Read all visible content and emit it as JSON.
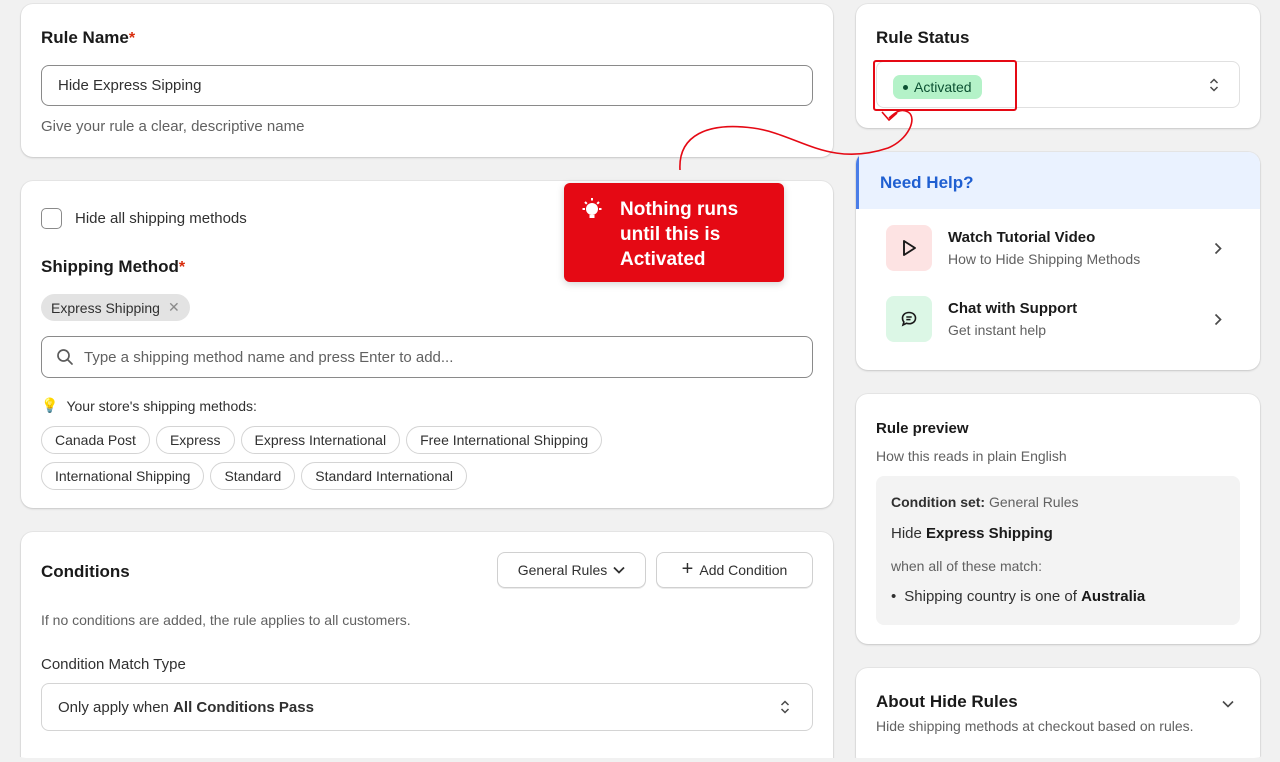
{
  "rule_name": {
    "label": "Rule Name",
    "required_mark": "*",
    "value": "Hide Express Sipping",
    "help": "Give your rule a clear, descriptive name"
  },
  "shipping": {
    "hide_all_label": "Hide all shipping methods",
    "method_label": "Shipping Method",
    "required_mark": "*",
    "selected_tag": "Express Shipping",
    "search_placeholder": "Type a shipping method name and press Enter to add...",
    "store_methods_label": "Your store's shipping methods:",
    "store_methods": [
      "Canada Post",
      "Express",
      "Express International",
      "Free International Shipping",
      "International Shipping",
      "Standard",
      "Standard International"
    ]
  },
  "conditions": {
    "title": "Conditions",
    "condition_set_button": "General Rules",
    "add_button": "Add Condition",
    "empty_note": "If no conditions are added, the rule applies to all customers.",
    "match_type_label": "Condition Match Type",
    "match_prefix": "Only apply when ",
    "match_value": "All Conditions Pass"
  },
  "rule_status": {
    "title": "Rule Status",
    "value": "Activated"
  },
  "callout": {
    "text": "Nothing runs until this is Activated",
    "color": "#e50914"
  },
  "help": {
    "title": "Need Help?",
    "items": [
      {
        "title": "Watch Tutorial Video",
        "subtitle": "How to Hide Shipping Methods",
        "icon": "play-icon"
      },
      {
        "title": "Chat with Support",
        "subtitle": "Get instant help",
        "icon": "chat-icon"
      }
    ]
  },
  "preview": {
    "title": "Rule preview",
    "subtitle": "How this reads in plain English",
    "condition_set_label": "Condition set:",
    "condition_set_value": "General Rules",
    "hide_prefix": "Hide",
    "hide_method": "Express Shipping",
    "match_text": "when all of these match:",
    "bullet_prefix": "Shipping country is one of",
    "bullet_value": "Australia"
  },
  "about": {
    "title": "About Hide Rules",
    "subtitle": "Hide shipping methods at checkout based on rules."
  },
  "colors": {
    "accent_blue": "#1f5fd1",
    "status_green": "#b4f2c8",
    "highlight_red": "#e50914"
  }
}
